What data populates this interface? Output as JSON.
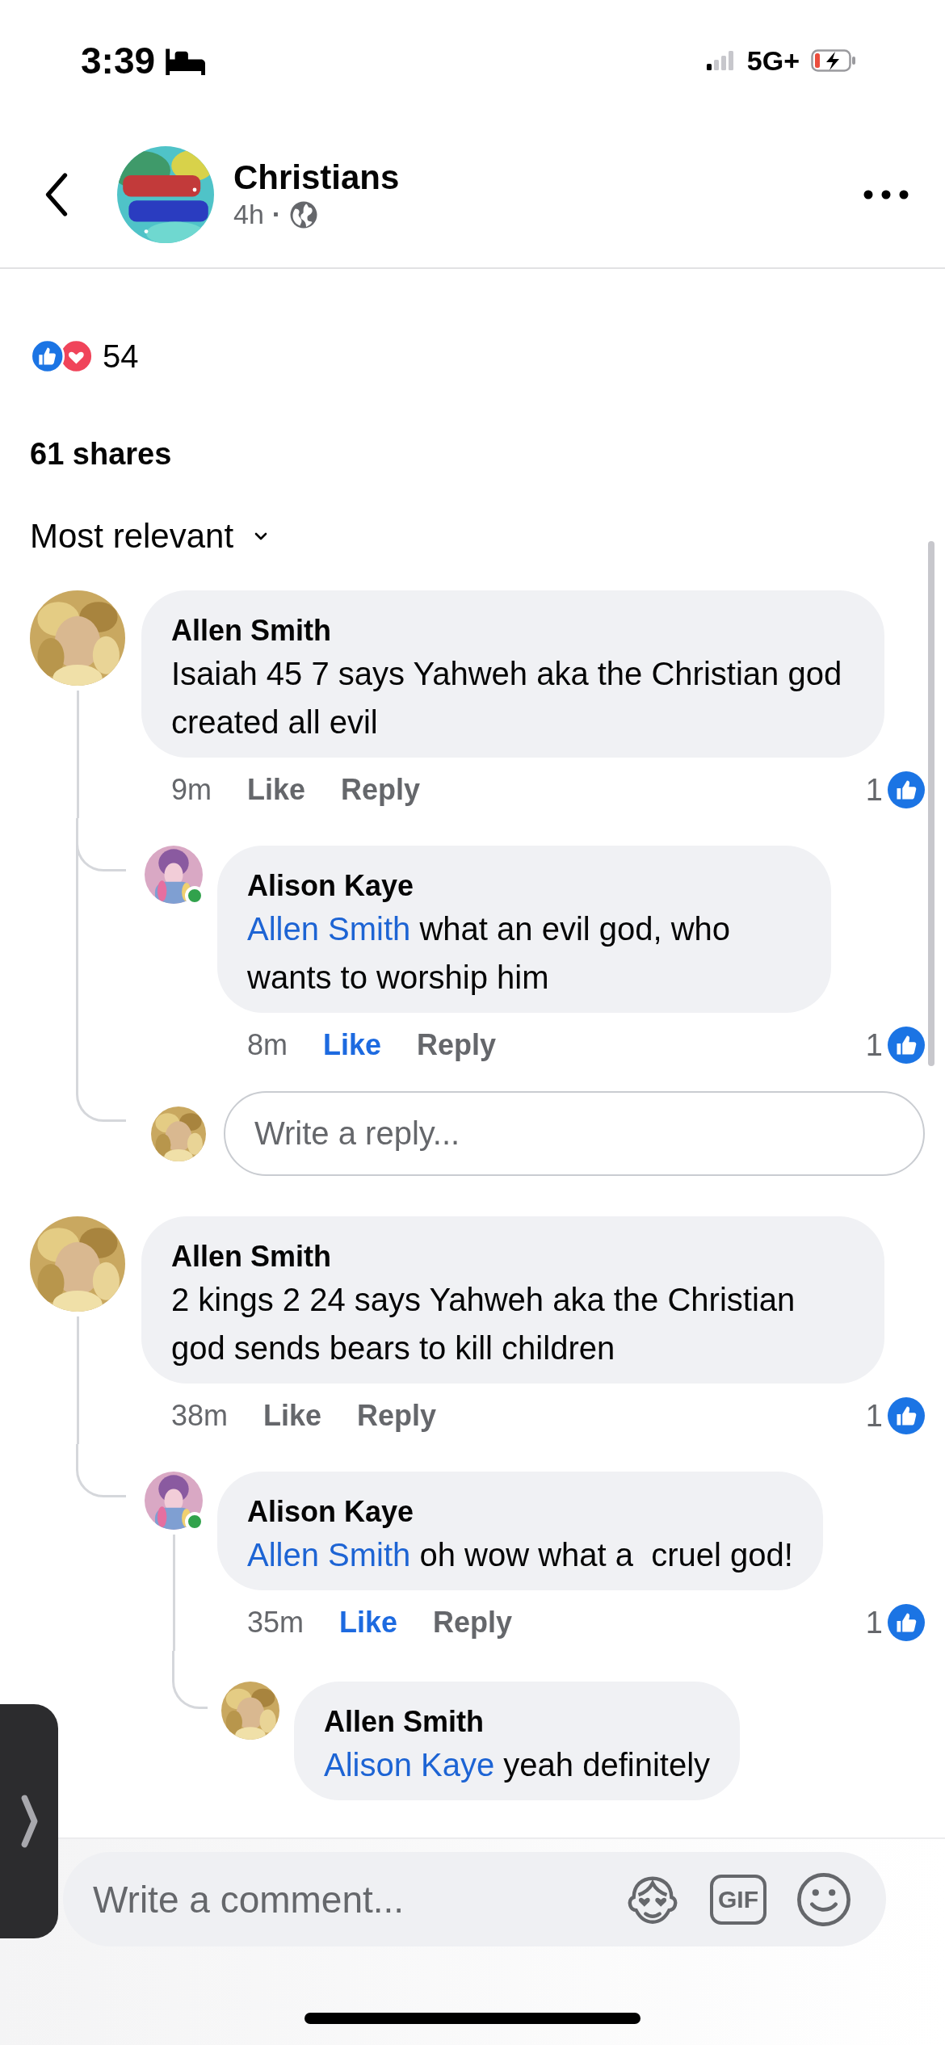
{
  "status_bar": {
    "time": "3:39",
    "network": "5G+"
  },
  "header": {
    "title": "Christians",
    "age": "4h",
    "separator": "·"
  },
  "reactions": {
    "count": "54"
  },
  "shares": "61 shares",
  "sort": {
    "label": "Most relevant"
  },
  "comments": [
    {
      "author": "Allen Smith",
      "online": false,
      "text": "Isaiah 45 7 says Yahweh aka the Christian god created all evil",
      "time": "9m",
      "like_label": "Like",
      "liked": false,
      "reply_label": "Reply",
      "like_count": "1",
      "replies": [
        {
          "author": "Alison Kaye",
          "online": true,
          "mention": "Allen Smith",
          "text": "what an evil god, who wants to worship him",
          "time": "8m",
          "like_label": "Like",
          "liked": true,
          "reply_label": "Reply",
          "like_count": "1"
        }
      ],
      "reply_field": {
        "placeholder": "Write a reply..."
      }
    },
    {
      "author": "Allen Smith",
      "online": false,
      "text": "2 kings 2 24 says Yahweh aka the Christian god sends bears to kill children",
      "time": "38m",
      "like_label": "Like",
      "liked": false,
      "reply_label": "Reply",
      "like_count": "1",
      "replies": [
        {
          "author": "Alison Kaye",
          "online": true,
          "mention": "Allen Smith",
          "text": "oh wow what a  cruel god!",
          "time": "35m",
          "like_label": "Like",
          "liked": true,
          "reply_label": "Reply",
          "like_count": "1",
          "replies": [
            {
              "author": "Allen Smith",
              "online": false,
              "mention": "Alison Kaye",
              "text": "yeah definitely"
            }
          ]
        }
      ]
    }
  ],
  "composer": {
    "placeholder": "Write a comment...",
    "gif_label": "GIF"
  }
}
